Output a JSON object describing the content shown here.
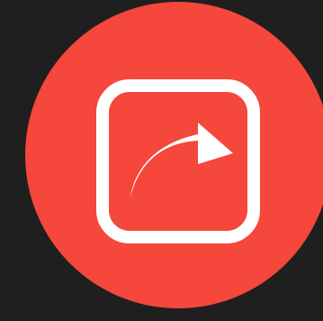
{
  "colors": {
    "background": "#1f1f1f",
    "button_fill": "#f5473b",
    "icon_color": "#ffffff"
  },
  "share_button": {
    "icon": "share-forward-arrow-icon"
  }
}
